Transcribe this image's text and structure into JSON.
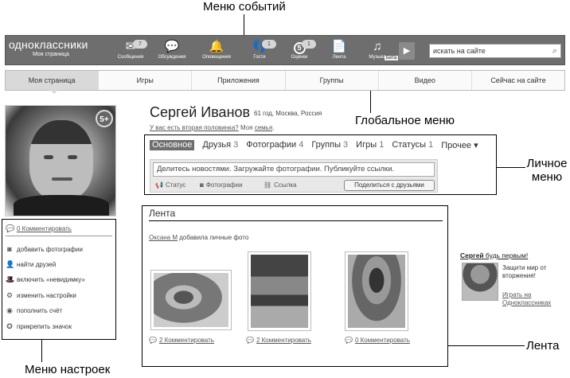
{
  "callouts": {
    "events_menu": "Меню событий",
    "global_menu": "Глобальное меню",
    "personal_menu": "Личное меню",
    "feed": "Лента",
    "settings_menu": "Меню настроек"
  },
  "topbar": {
    "logo": "одноклассники",
    "logo_sub": "Моя страница",
    "events": [
      {
        "label": "Сообщения",
        "icon": "envelope-icon",
        "badge": "7"
      },
      {
        "label": "Обсуждения",
        "icon": "chat-bubbles-icon",
        "badge": ""
      },
      {
        "label": "Оповещения",
        "icon": "bell-icon",
        "badge": ""
      },
      {
        "label": "Гости",
        "icon": "footprints-icon",
        "badge": "1"
      },
      {
        "label": "Оценки",
        "icon": "five-star-icon",
        "badge": "1",
        "circle": "5"
      },
      {
        "label": "Лента",
        "icon": "feed-icon",
        "badge": ""
      },
      {
        "label": "Музыка",
        "icon": "music-note-icon",
        "badge": ""
      }
    ],
    "beta": "Бета",
    "search_placeholder": "искать на сайте"
  },
  "global_nav": [
    "Моя страница",
    "Игры",
    "Приложения",
    "Группы",
    "Видео",
    "Сейчас на сайте"
  ],
  "profile": {
    "age_badge": "5+",
    "name": "Сергей Иванов",
    "info": "61 год, Москва, Россия",
    "question": "У вас есть вторая половинка?",
    "my_label": "Моя",
    "family_link": "семья",
    "period": "."
  },
  "settings_menu": {
    "comment_link": "0 Комментировать",
    "items": [
      {
        "label": "добавить фотографии",
        "icon": "camera-icon"
      },
      {
        "label": "найти друзей",
        "icon": "person-icon"
      },
      {
        "label": "включить «невидимку»",
        "icon": "hat-icon"
      },
      {
        "label": "изменить настройки",
        "icon": "gear-icon"
      },
      {
        "label": "пополнить счёт",
        "icon": "ok-coin-icon"
      },
      {
        "label": "прикрепить значок",
        "icon": "star-badge-icon"
      }
    ]
  },
  "personal_menu": {
    "tabs": [
      {
        "label": "Основное",
        "count": ""
      },
      {
        "label": "Друзья",
        "count": "3"
      },
      {
        "label": "Фотографии",
        "count": "4"
      },
      {
        "label": "Группы",
        "count": "3"
      },
      {
        "label": "Игры",
        "count": "1"
      },
      {
        "label": "Статусы",
        "count": "1"
      },
      {
        "label": "Прочее ▾",
        "count": ""
      }
    ],
    "status_placeholder": "Делитесь новостями. Загружайте фотографии. Публикуйте ссылки.",
    "actions": [
      "Статус",
      "Фотографии",
      "Ссылка"
    ],
    "share_button": "Поделиться с друзьями"
  },
  "feed": {
    "title": "Лента",
    "author": "Оксана М",
    "action": " добавила личные фото",
    "comments": [
      "2 Комментировать",
      "2 Комментировать",
      "0 Комментировать"
    ]
  },
  "promo": {
    "title_name": "Сергей",
    "title_rest": " будь первым!",
    "text": "Защити мир от вторжения!",
    "link": "Играть на Одноклассниках"
  }
}
